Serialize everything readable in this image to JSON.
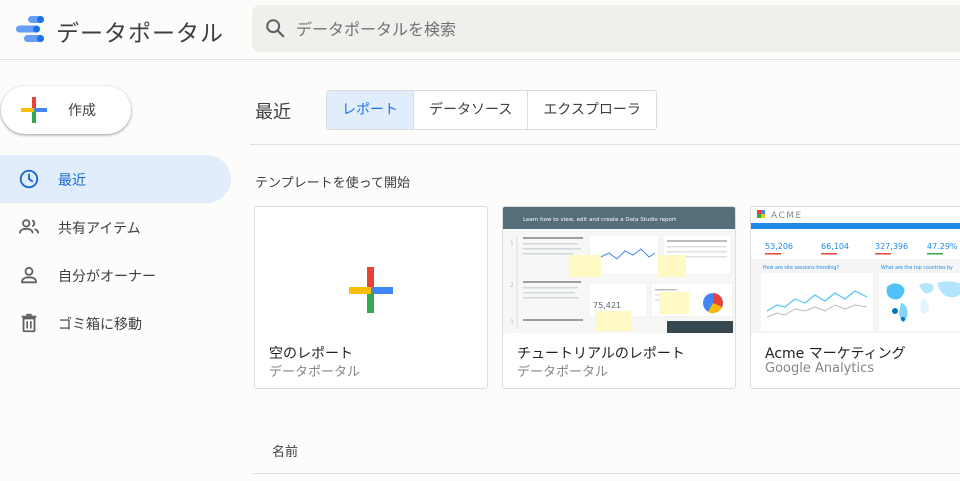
{
  "header": {
    "app_title": "データポータル",
    "search_placeholder": "データポータルを検索"
  },
  "sidebar": {
    "create_label": "作成",
    "items": [
      {
        "label": "最近",
        "icon": "clock-icon",
        "active": true
      },
      {
        "label": "共有アイテム",
        "icon": "people-icon",
        "active": false
      },
      {
        "label": "自分がオーナー",
        "icon": "person-icon",
        "active": false
      },
      {
        "label": "ゴミ箱に移動",
        "icon": "trash-icon",
        "active": false
      }
    ]
  },
  "main": {
    "section_title": "最近",
    "tabs": [
      {
        "label": "レポート",
        "active": true
      },
      {
        "label": "データソース",
        "active": false
      },
      {
        "label": "エクスプローラ",
        "active": false
      }
    ],
    "templates_heading": "テンプレートを使って開始",
    "templates": [
      {
        "name": "空のレポート",
        "source": "データポータル"
      },
      {
        "name": "チュートリアルのレポート",
        "source": "データポータル"
      },
      {
        "name": "Acme マーケティング",
        "source": "Google Analytics"
      }
    ],
    "list_header_name": "名前"
  },
  "thumbnails": {
    "tutorial_banner": "Learn how to view, edit and create a Data Studio report",
    "tutorial_metric": "75,421",
    "acme_logo": "ACME",
    "acme_metrics": [
      "53,206",
      "66,104",
      "327,396",
      "47.29%"
    ],
    "acme_chart_title": "How are site sessions trending?",
    "acme_map_title": "What are the top countries by"
  },
  "colors": {
    "accent": "#1a73e8",
    "active_bg": "#e2edfb",
    "plus_red": "#ea4335",
    "plus_yellow": "#fbbc04",
    "plus_green": "#34a853",
    "plus_blue": "#4285f4"
  }
}
